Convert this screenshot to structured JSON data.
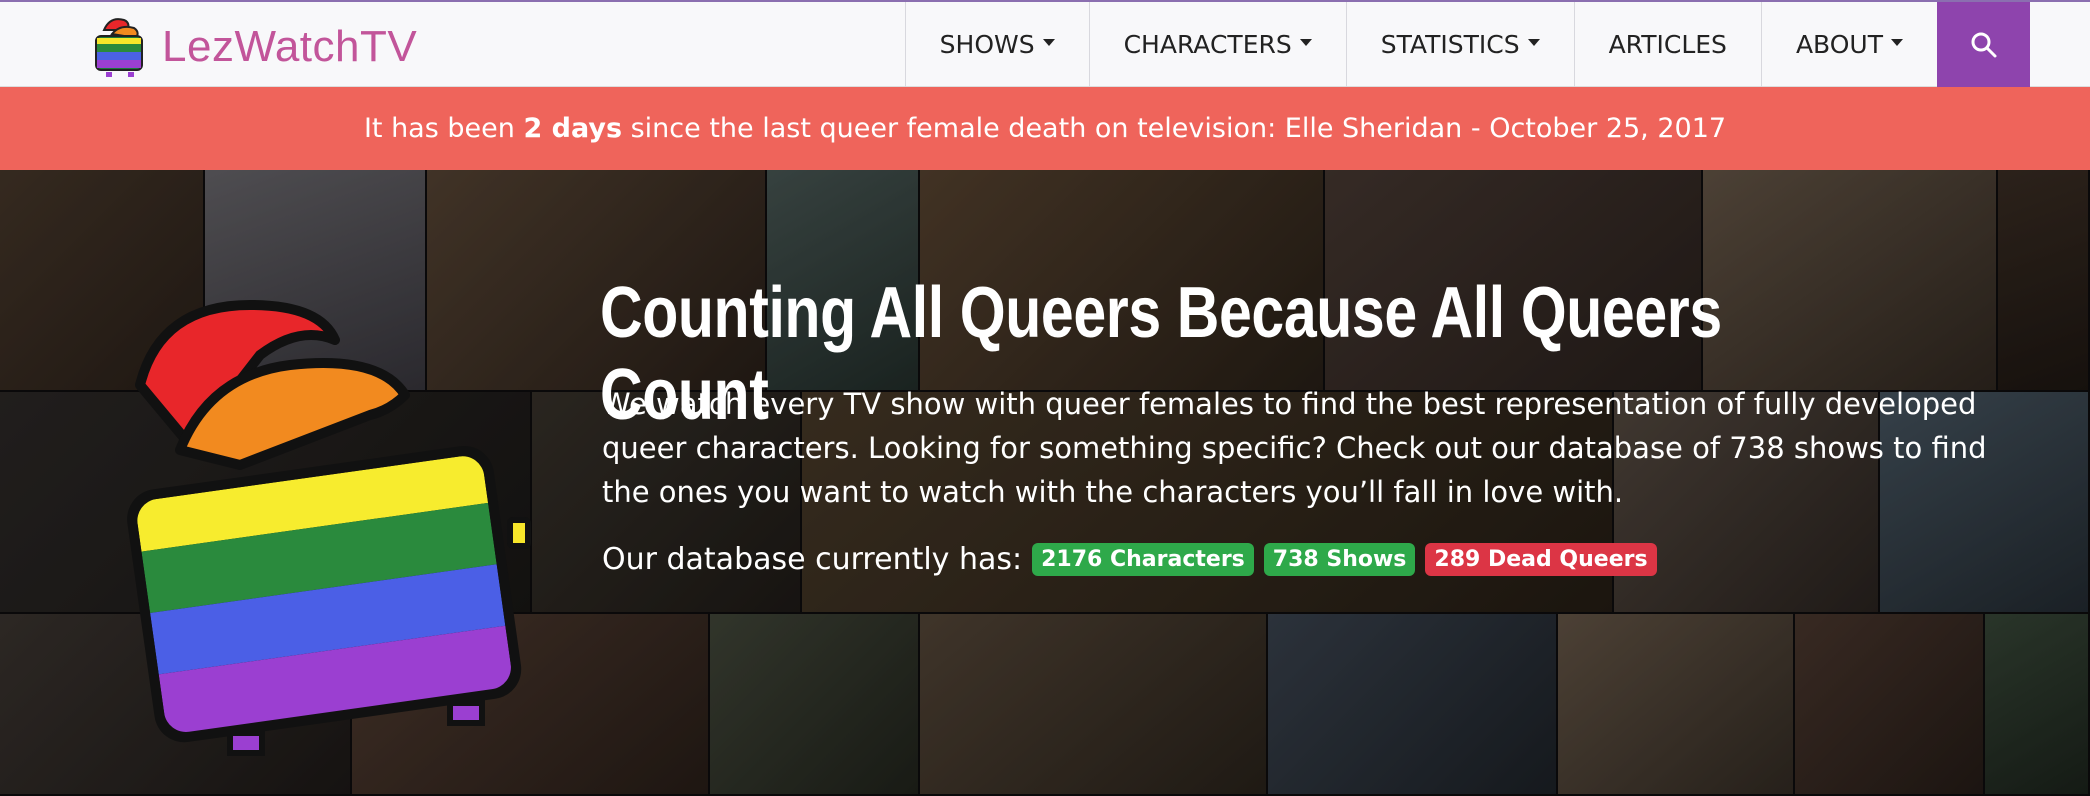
{
  "brand": {
    "name": "LezWatchTV"
  },
  "nav": {
    "items": [
      {
        "label": "SHOWS",
        "dropdown": true
      },
      {
        "label": "CHARACTERS",
        "dropdown": true
      },
      {
        "label": "STATISTICS",
        "dropdown": true
      },
      {
        "label": "ARTICLES",
        "dropdown": false
      },
      {
        "label": "ABOUT",
        "dropdown": true
      }
    ],
    "search_icon": "search-icon"
  },
  "alert": {
    "prefix": "It has been ",
    "days": "2 days",
    "suffix": " since the last queer female death on television: Elle Sheridan - October 25, 2017"
  },
  "hero": {
    "headline": "Counting All Queers Because All Queers Count",
    "lead": "We watch every TV show with queer females to find the best representation of fully developed queer characters. Looking for something specific? Check out our database of 738 shows to find the ones you want to watch with the characters you’ll fall in love with.",
    "db_label": "Our database currently has:",
    "badges": {
      "characters": "2176 Characters",
      "shows": "738 Shows",
      "dead": "289 Dead Queers"
    }
  },
  "colors": {
    "brand": "#c2559a",
    "search_bg": "#8e44ad",
    "alert_bg": "#ef645b",
    "badge_green": "#2ea94a",
    "badge_red": "#dc3545"
  }
}
